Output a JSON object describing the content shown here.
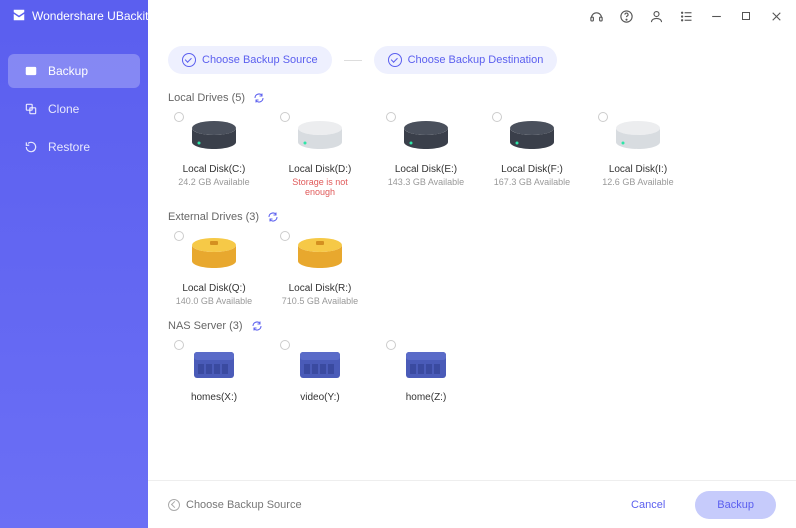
{
  "app": {
    "title": "Wondershare UBackit"
  },
  "sidebar": {
    "items": [
      {
        "label": "Backup",
        "active": true
      },
      {
        "label": "Clone",
        "active": false
      },
      {
        "label": "Restore",
        "active": false
      }
    ]
  },
  "steps": [
    {
      "label": "Choose Backup Source"
    },
    {
      "label": "Choose Backup Destination"
    }
  ],
  "sections": [
    {
      "title": "Local Drives (5)",
      "type": "local",
      "drives": [
        {
          "label": "Local Disk(C:)",
          "sub": "24.2 GB Available",
          "color": "dark"
        },
        {
          "label": "Local Disk(D:)",
          "sub": "Storage is not enough",
          "color": "light",
          "error": true
        },
        {
          "label": "Local Disk(E:)",
          "sub": "143.3 GB Available",
          "color": "dark"
        },
        {
          "label": "Local Disk(F:)",
          "sub": "167.3 GB Available",
          "color": "dark"
        },
        {
          "label": "Local Disk(I:)",
          "sub": "12.6 GB Available",
          "color": "light"
        }
      ]
    },
    {
      "title": "External Drives (3)",
      "type": "external",
      "drives": [
        {
          "label": "Local Disk(Q:)",
          "sub": "140.0 GB Available"
        },
        {
          "label": "Local Disk(R:)",
          "sub": "710.5 GB Available"
        }
      ]
    },
    {
      "title": "NAS Server (3)",
      "type": "nas",
      "drives": [
        {
          "label": "homes(X:)",
          "sub": ""
        },
        {
          "label": "video(Y:)",
          "sub": ""
        },
        {
          "label": "home(Z:)",
          "sub": ""
        }
      ]
    }
  ],
  "footer": {
    "hint": "Choose Backup Source",
    "cancel": "Cancel",
    "primary": "Backup"
  }
}
